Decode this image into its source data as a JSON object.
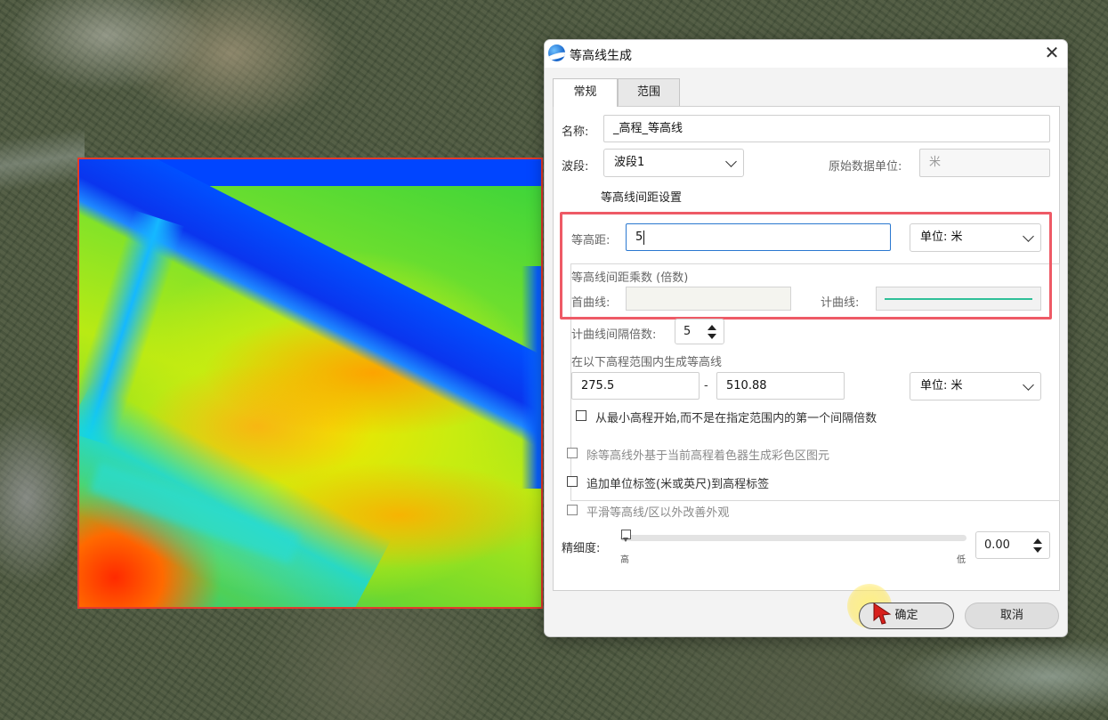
{
  "dialog": {
    "title": "等高线生成",
    "close_glyph": "✕"
  },
  "tabs": [
    {
      "label": "常规",
      "active": true
    },
    {
      "label": "范围",
      "active": false
    }
  ],
  "general": {
    "name_label": "名称:",
    "name_value": "_高程_等高线",
    "band_label": "波段:",
    "band_value": "波段1",
    "source_unit_label": "原始数据单位:",
    "source_unit_value": "米"
  },
  "interval_group": {
    "title": "等高线间距设置",
    "interval_label": "等高距:",
    "interval_value": "5",
    "unit_select": "单位: 米",
    "multiplier_label": "等高线间距乘数 (倍数)",
    "first_line_label": "首曲线:",
    "index_line_label": "计曲线:",
    "index_line_color": "#2fbf98",
    "index_interval_label": "计曲线间隔倍数:",
    "index_interval_value": "5",
    "range_label": "在以下高程范围内生成等高线",
    "range_min": "275.5",
    "range_sep": "-",
    "range_max": "510.88",
    "range_unit_select": "单位: 米",
    "start_from_min_label": "从最小高程开始,而不是在指定范围内的第一个间隔倍数"
  },
  "options": {
    "color_fill_label": "除等高线外基于当前高程着色器生成彩色区图元",
    "unit_label_label": "追加单位标签(米或英尺)到高程标签",
    "smooth_label": "平滑等高线/区以外改善外观"
  },
  "fineness": {
    "label": "精细度:",
    "high_label": "高",
    "low_label": "低",
    "value": "0.00",
    "slider_level": 0.0
  },
  "buttons": {
    "ok": "确定",
    "cancel": "取消"
  },
  "colors": {
    "highlight_border": "#ee5a66",
    "raster_border": "#e53b2d"
  }
}
